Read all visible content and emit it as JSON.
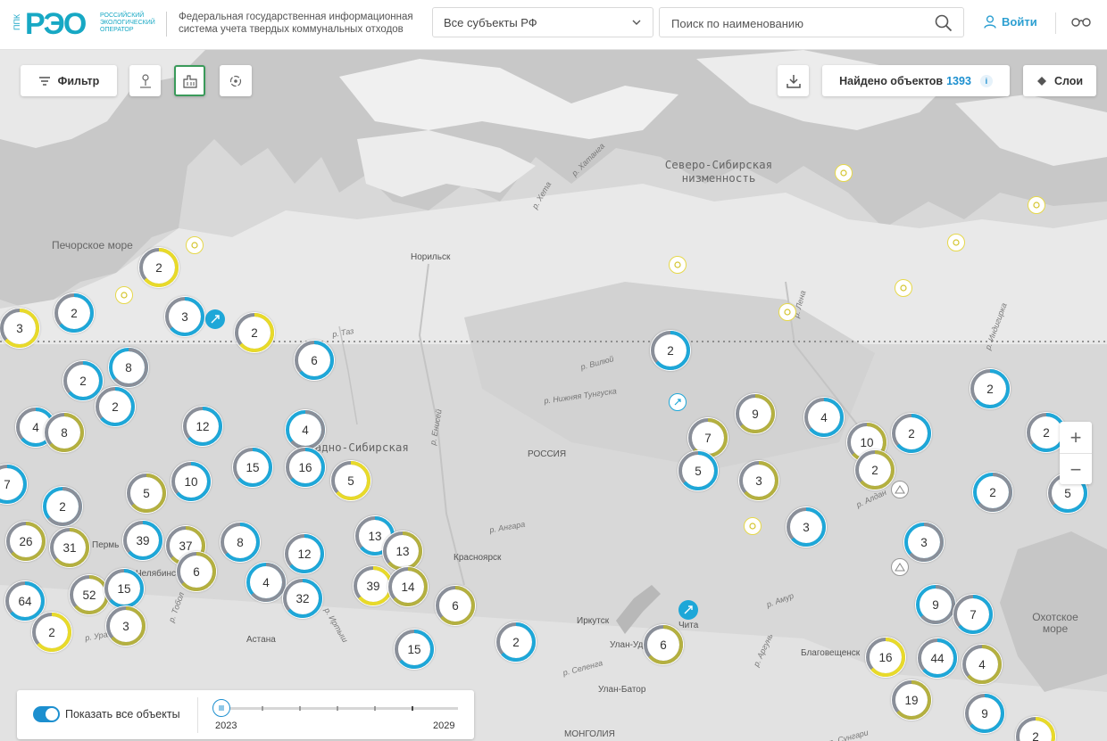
{
  "header": {
    "logo_ppk": "ППК",
    "logo_mark": "РЭО",
    "logo_subtitle": "РОССИЙСКИЙ ЭКОЛОГИЧЕСКИЙ ОПЕРАТОР",
    "site_title": "Федеральная государственная информационная система учета твердых коммунальных отходов",
    "region_select_value": "Все субъекты РФ",
    "search_placeholder": "Поиск по наименованию",
    "login_label": "Войти"
  },
  "toolbar": {
    "filter_label": "Фильтр",
    "found_label": "Найдено объектов",
    "found_count": "1393",
    "layers_label": "Слои"
  },
  "map_labels": {
    "pechora_sea": "Печорское море",
    "north_siberian_lowland": "Северо-Сибирская низменность",
    "west_siberian": "Западно-Сибирская",
    "russia": "РОССИЯ",
    "okhotsk_sea": "Охотское море",
    "mongolia": "МОНГОЛИЯ",
    "norilsk": "Норильск",
    "perm": "Пермь",
    "chelyabinsk": "Челябинск",
    "astana": "Астана",
    "krasnoyarsk": "Красноярск",
    "irkutsk": "Иркутск",
    "ulan_ude": "Улан-Удэ",
    "ulaanbaatar": "Улан-Батор",
    "chita": "Чита",
    "blagoveshchensk": "Благовещенск",
    "r_kheta": "р. Хета",
    "r_khatanga": "р. Хатанга",
    "r_vilyuy": "р. Вилюй",
    "r_nizh_tunguska": "р. Нижняя Тунгуска",
    "r_yenisei": "р. Енисей",
    "r_lena": "р. Лена",
    "r_angara": "р. Ангара",
    "r_taz": "р. Таз",
    "r_amur": "р. Амур",
    "r_aldan": "р. Алдан",
    "r_irtysh": "р. Иртыш",
    "r_selenga": "р. Селенга",
    "r_tobol": "р. Тобол",
    "r_argun": "р. Аргунь",
    "r_ural": "р. Урал",
    "r_indigirka": "р. Индигирка",
    "r_sungari": "р. Сунгари"
  },
  "clusters": [
    {
      "n": "3",
      "c": "y"
    },
    {
      "n": "2",
      "c": "b"
    },
    {
      "n": "2",
      "c": "y"
    },
    {
      "n": "3",
      "c": "b"
    },
    {
      "n": "2",
      "c": "y"
    },
    {
      "n": "6",
      "c": "b"
    },
    {
      "n": "8",
      "c": "g"
    },
    {
      "n": "2",
      "c": "b"
    },
    {
      "n": "2",
      "c": "b"
    },
    {
      "n": "4",
      "c": "b"
    },
    {
      "n": "8",
      "c": "o"
    },
    {
      "n": "12",
      "c": "b"
    },
    {
      "n": "15",
      "c": "b"
    },
    {
      "n": "4",
      "c": "g"
    },
    {
      "n": "16",
      "c": "b"
    },
    {
      "n": "5",
      "c": "y"
    },
    {
      "n": "7",
      "c": "b"
    },
    {
      "n": "2",
      "c": "g"
    },
    {
      "n": "5",
      "c": "o"
    },
    {
      "n": "10",
      "c": "b"
    },
    {
      "n": "26",
      "c": "o"
    },
    {
      "n": "31",
      "c": "o"
    },
    {
      "n": "39",
      "c": "b"
    },
    {
      "n": "37",
      "c": "o"
    },
    {
      "n": "8",
      "c": "b"
    },
    {
      "n": "6",
      "c": "o"
    },
    {
      "n": "12",
      "c": "b"
    },
    {
      "n": "13",
      "c": "b"
    },
    {
      "n": "13",
      "c": "o"
    },
    {
      "n": "64",
      "c": "b"
    },
    {
      "n": "52",
      "c": "o"
    },
    {
      "n": "15",
      "c": "b"
    },
    {
      "n": "4",
      "c": "g"
    },
    {
      "n": "32",
      "c": "b"
    },
    {
      "n": "39",
      "c": "y"
    },
    {
      "n": "14",
      "c": "o"
    },
    {
      "n": "6",
      "c": "o"
    },
    {
      "n": "2",
      "c": "b"
    },
    {
      "n": "3",
      "c": "o"
    },
    {
      "n": "15",
      "c": "b"
    },
    {
      "n": "2",
      "c": "y"
    },
    {
      "n": "2",
      "c": "b"
    },
    {
      "n": "9",
      "c": "o"
    },
    {
      "n": "7",
      "c": "o"
    },
    {
      "n": "5",
      "c": "b"
    },
    {
      "n": "3",
      "c": "o"
    },
    {
      "n": "4",
      "c": "b"
    },
    {
      "n": "10",
      "c": "o"
    },
    {
      "n": "2",
      "c": "b"
    },
    {
      "n": "2",
      "c": "o"
    },
    {
      "n": "3",
      "c": "b"
    },
    {
      "n": "3",
      "c": "g"
    },
    {
      "n": "2",
      "c": "b"
    },
    {
      "n": "2",
      "c": "b"
    },
    {
      "n": "2",
      "c": "g"
    },
    {
      "n": "5",
      "c": "b"
    },
    {
      "n": "6",
      "c": "o"
    },
    {
      "n": "9",
      "c": "g"
    },
    {
      "n": "7",
      "c": "b"
    },
    {
      "n": "16",
      "c": "y"
    },
    {
      "n": "44",
      "c": "b"
    },
    {
      "n": "4",
      "c": "o"
    },
    {
      "n": "19",
      "c": "o"
    },
    {
      "n": "9",
      "c": "b"
    },
    {
      "n": "2",
      "c": "y"
    }
  ],
  "bottom_panel": {
    "toggle_label": "Показать все объекты",
    "year_start": "2023",
    "year_end": "2029"
  },
  "colors": {
    "brand": "#17a8c4",
    "ring_blue": "#1ea7d8",
    "ring_yellow": "#e8da2a",
    "ring_olive": "#b4b040",
    "ring_gray": "#8a8f99",
    "active_green": "#3a9a5a"
  },
  "icons": [
    "search-icon",
    "chevron-down-icon",
    "user-icon",
    "glasses-icon",
    "filter-icon",
    "landfill-icon",
    "factory-icon",
    "recycle-icon",
    "download-icon",
    "info-icon",
    "layers-icon",
    "zoom-in-icon",
    "zoom-out-icon"
  ]
}
